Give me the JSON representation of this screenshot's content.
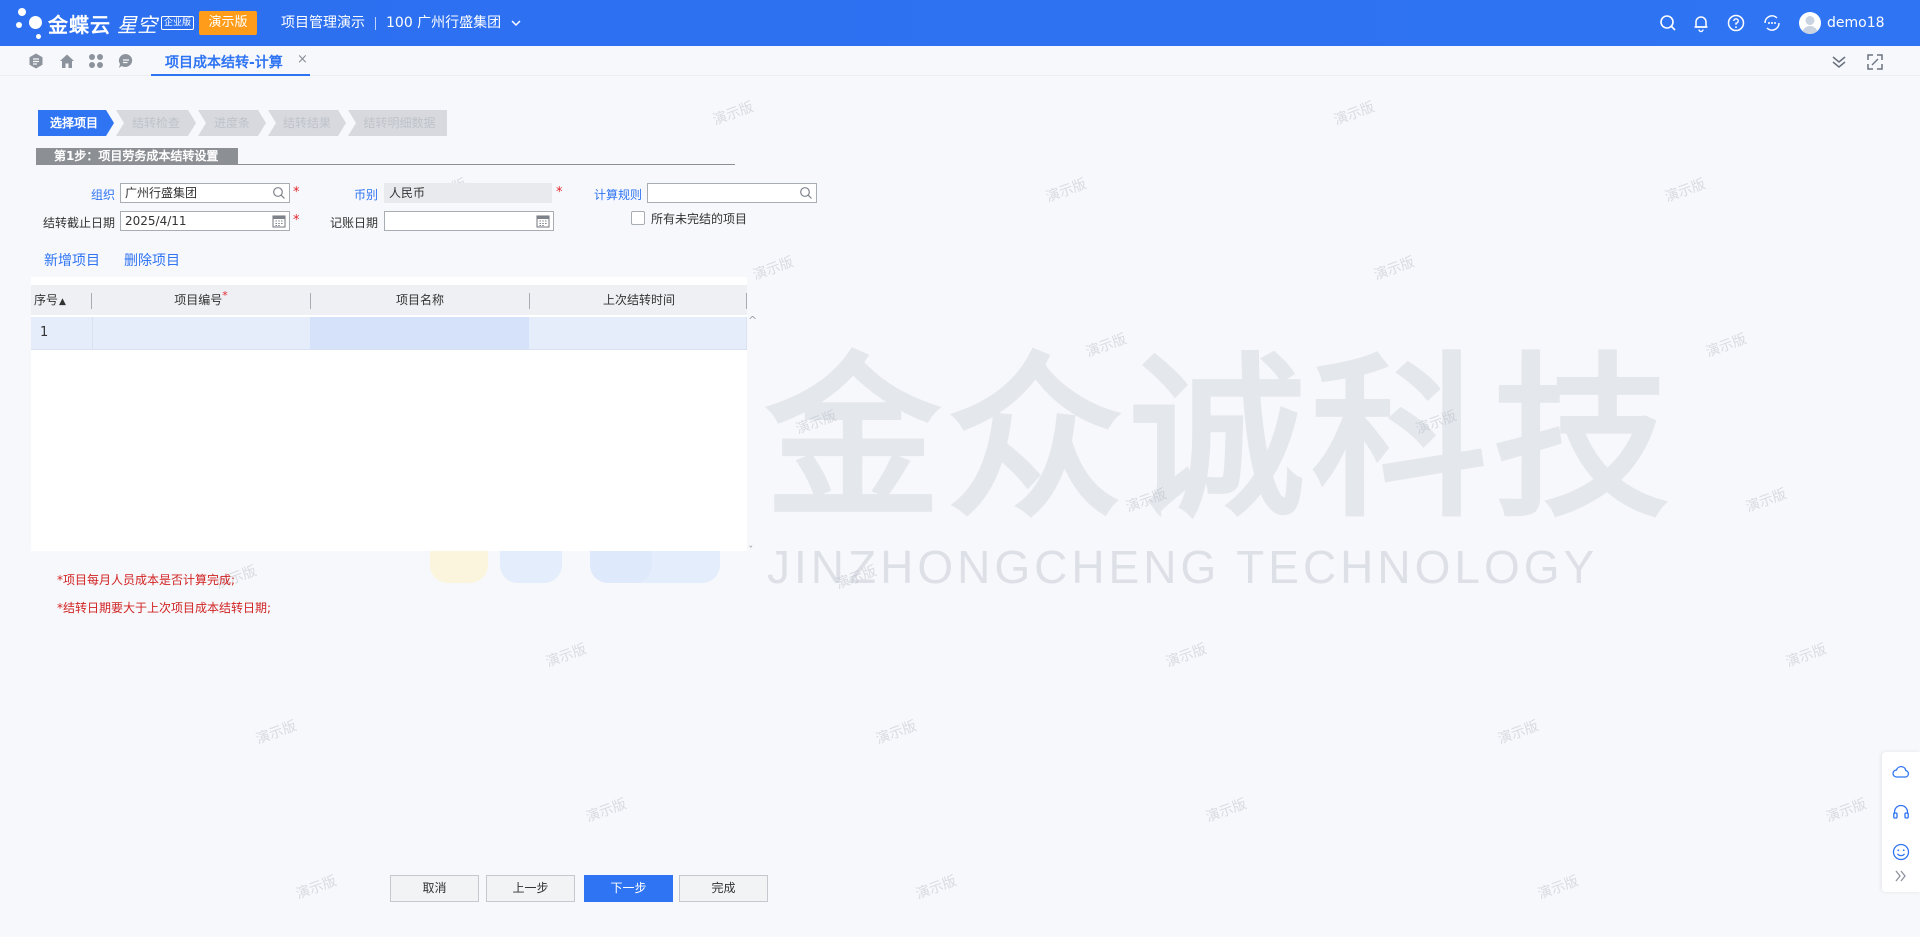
{
  "header": {
    "logo_text": "金蝶云",
    "logo_text2": "星空",
    "logo_badge": "企业版",
    "demo_badge": "演示版",
    "app_name": "项目管理演示",
    "org": "100 广州行盛集团",
    "username": "demo18",
    "icons": [
      "search-icon",
      "bell-icon",
      "help-icon",
      "apps-icon",
      "user-avatar"
    ]
  },
  "tabbar": {
    "left_icons": [
      "switch-icon",
      "home-icon",
      "grid-icon",
      "message-icon"
    ],
    "active_tab": "项目成本结转-计算",
    "close": "×",
    "right_icons": [
      "collapse-icon",
      "fullscreen-icon"
    ]
  },
  "steps": [
    "选择项目",
    "结转检查",
    "进度条",
    "结转结果",
    "结转明细数据"
  ],
  "section": {
    "title": "第1步：项目劳务成本结转设置"
  },
  "form": {
    "org_label": "组织",
    "org_value": "广州行盛集团",
    "currency_label": "币别",
    "currency_value": "人民币",
    "rule_label": "计算规则",
    "rule_value": "",
    "cutoff_label": "结转截止日期",
    "cutoff_value": "2025/4/11",
    "posting_label": "记账日期",
    "posting_value": "",
    "unfinished_label": "所有未完结的项目",
    "required_mark": "*"
  },
  "actions": {
    "add": "新增项目",
    "delete": "删除项目"
  },
  "grid": {
    "columns": [
      "序号",
      "项目编号",
      "项目名称",
      "上次结转时间"
    ],
    "sort_glyph": "▲",
    "rows": [
      {
        "seq": "1",
        "code": "",
        "name": "",
        "last": ""
      }
    ],
    "scroll_up": "^",
    "scroll_down": "ˇ"
  },
  "notes": [
    "*项目每月人员成本是否计算完成;",
    "*结转日期要大于上次项目成本结转日期;"
  ],
  "buttons": {
    "cancel": "取消",
    "prev": "上一步",
    "next": "下一步",
    "finish": "完成"
  },
  "watermark": {
    "text": "演示版",
    "brand_cn": "金众诚科技",
    "brand_en": "JINZHONGCHENG TECHNOLOGY"
  },
  "float_icons": [
    "cloud-icon",
    "headset-icon",
    "smile-icon",
    "double-chevron-icon"
  ],
  "colors": {
    "primary": "#2f74f3",
    "orange": "#ff9c19",
    "required": "#e0262b",
    "note": "#d12323"
  }
}
